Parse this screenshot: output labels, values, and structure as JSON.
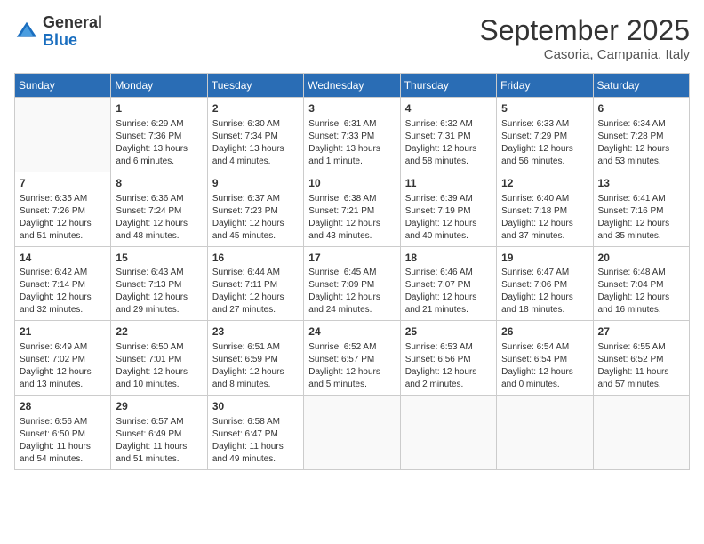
{
  "logo": {
    "general": "General",
    "blue": "Blue"
  },
  "title": "September 2025",
  "location": "Casoria, Campania, Italy",
  "days_of_week": [
    "Sunday",
    "Monday",
    "Tuesday",
    "Wednesday",
    "Thursday",
    "Friday",
    "Saturday"
  ],
  "weeks": [
    [
      {
        "day": "",
        "content": ""
      },
      {
        "day": "1",
        "content": "Sunrise: 6:29 AM\nSunset: 7:36 PM\nDaylight: 13 hours\nand 6 minutes."
      },
      {
        "day": "2",
        "content": "Sunrise: 6:30 AM\nSunset: 7:34 PM\nDaylight: 13 hours\nand 4 minutes."
      },
      {
        "day": "3",
        "content": "Sunrise: 6:31 AM\nSunset: 7:33 PM\nDaylight: 13 hours\nand 1 minute."
      },
      {
        "day": "4",
        "content": "Sunrise: 6:32 AM\nSunset: 7:31 PM\nDaylight: 12 hours\nand 58 minutes."
      },
      {
        "day": "5",
        "content": "Sunrise: 6:33 AM\nSunset: 7:29 PM\nDaylight: 12 hours\nand 56 minutes."
      },
      {
        "day": "6",
        "content": "Sunrise: 6:34 AM\nSunset: 7:28 PM\nDaylight: 12 hours\nand 53 minutes."
      }
    ],
    [
      {
        "day": "7",
        "content": "Sunrise: 6:35 AM\nSunset: 7:26 PM\nDaylight: 12 hours\nand 51 minutes."
      },
      {
        "day": "8",
        "content": "Sunrise: 6:36 AM\nSunset: 7:24 PM\nDaylight: 12 hours\nand 48 minutes."
      },
      {
        "day": "9",
        "content": "Sunrise: 6:37 AM\nSunset: 7:23 PM\nDaylight: 12 hours\nand 45 minutes."
      },
      {
        "day": "10",
        "content": "Sunrise: 6:38 AM\nSunset: 7:21 PM\nDaylight: 12 hours\nand 43 minutes."
      },
      {
        "day": "11",
        "content": "Sunrise: 6:39 AM\nSunset: 7:19 PM\nDaylight: 12 hours\nand 40 minutes."
      },
      {
        "day": "12",
        "content": "Sunrise: 6:40 AM\nSunset: 7:18 PM\nDaylight: 12 hours\nand 37 minutes."
      },
      {
        "day": "13",
        "content": "Sunrise: 6:41 AM\nSunset: 7:16 PM\nDaylight: 12 hours\nand 35 minutes."
      }
    ],
    [
      {
        "day": "14",
        "content": "Sunrise: 6:42 AM\nSunset: 7:14 PM\nDaylight: 12 hours\nand 32 minutes."
      },
      {
        "day": "15",
        "content": "Sunrise: 6:43 AM\nSunset: 7:13 PM\nDaylight: 12 hours\nand 29 minutes."
      },
      {
        "day": "16",
        "content": "Sunrise: 6:44 AM\nSunset: 7:11 PM\nDaylight: 12 hours\nand 27 minutes."
      },
      {
        "day": "17",
        "content": "Sunrise: 6:45 AM\nSunset: 7:09 PM\nDaylight: 12 hours\nand 24 minutes."
      },
      {
        "day": "18",
        "content": "Sunrise: 6:46 AM\nSunset: 7:07 PM\nDaylight: 12 hours\nand 21 minutes."
      },
      {
        "day": "19",
        "content": "Sunrise: 6:47 AM\nSunset: 7:06 PM\nDaylight: 12 hours\nand 18 minutes."
      },
      {
        "day": "20",
        "content": "Sunrise: 6:48 AM\nSunset: 7:04 PM\nDaylight: 12 hours\nand 16 minutes."
      }
    ],
    [
      {
        "day": "21",
        "content": "Sunrise: 6:49 AM\nSunset: 7:02 PM\nDaylight: 12 hours\nand 13 minutes."
      },
      {
        "day": "22",
        "content": "Sunrise: 6:50 AM\nSunset: 7:01 PM\nDaylight: 12 hours\nand 10 minutes."
      },
      {
        "day": "23",
        "content": "Sunrise: 6:51 AM\nSunset: 6:59 PM\nDaylight: 12 hours\nand 8 minutes."
      },
      {
        "day": "24",
        "content": "Sunrise: 6:52 AM\nSunset: 6:57 PM\nDaylight: 12 hours\nand 5 minutes."
      },
      {
        "day": "25",
        "content": "Sunrise: 6:53 AM\nSunset: 6:56 PM\nDaylight: 12 hours\nand 2 minutes."
      },
      {
        "day": "26",
        "content": "Sunrise: 6:54 AM\nSunset: 6:54 PM\nDaylight: 12 hours\nand 0 minutes."
      },
      {
        "day": "27",
        "content": "Sunrise: 6:55 AM\nSunset: 6:52 PM\nDaylight: 11 hours\nand 57 minutes."
      }
    ],
    [
      {
        "day": "28",
        "content": "Sunrise: 6:56 AM\nSunset: 6:50 PM\nDaylight: 11 hours\nand 54 minutes."
      },
      {
        "day": "29",
        "content": "Sunrise: 6:57 AM\nSunset: 6:49 PM\nDaylight: 11 hours\nand 51 minutes."
      },
      {
        "day": "30",
        "content": "Sunrise: 6:58 AM\nSunset: 6:47 PM\nDaylight: 11 hours\nand 49 minutes."
      },
      {
        "day": "",
        "content": ""
      },
      {
        "day": "",
        "content": ""
      },
      {
        "day": "",
        "content": ""
      },
      {
        "day": "",
        "content": ""
      }
    ]
  ]
}
